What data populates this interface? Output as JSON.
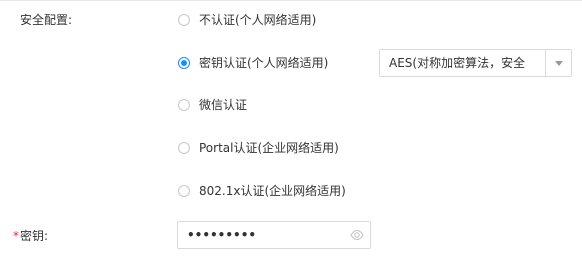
{
  "form": {
    "security_label": "安全配置:",
    "key_required_mark": "*",
    "key_label": "密钥:",
    "options": [
      {
        "label": "不认证(个人网络适用)",
        "checked": false
      },
      {
        "label": "密钥认证(个人网络适用)",
        "checked": true
      },
      {
        "label": "微信认证",
        "checked": false
      },
      {
        "label": "Portal认证(企业网络适用)",
        "checked": false
      },
      {
        "label": "802.1x认证(企业网络适用)",
        "checked": false
      }
    ],
    "encryption_select": {
      "value": "AES(对称加密算法，安全"
    },
    "password": {
      "masked_value": "•••••••••"
    }
  },
  "colors": {
    "accent": "#1890ff",
    "required": "#f5222d",
    "border": "#d9d9d9",
    "text": "#333333",
    "icon": "#c0c0c0"
  },
  "icons": {
    "select_arrow": "chevron-down-icon",
    "password_toggle": "eye-icon"
  }
}
